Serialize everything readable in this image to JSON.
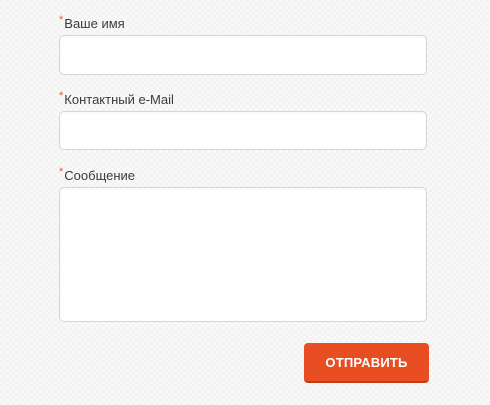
{
  "form": {
    "required_marker": "*",
    "name_label": "Ваше имя",
    "name_value": "",
    "email_label": "Контактный e-Mail",
    "email_value": "",
    "message_label": "Сообщение",
    "message_value": "",
    "submit_label": "ОТПРАВИТЬ"
  },
  "colors": {
    "accent": "#e84e22",
    "required_marker": "#e8532a",
    "field_border": "#d6d6d6",
    "background": "#f2f2f2"
  }
}
